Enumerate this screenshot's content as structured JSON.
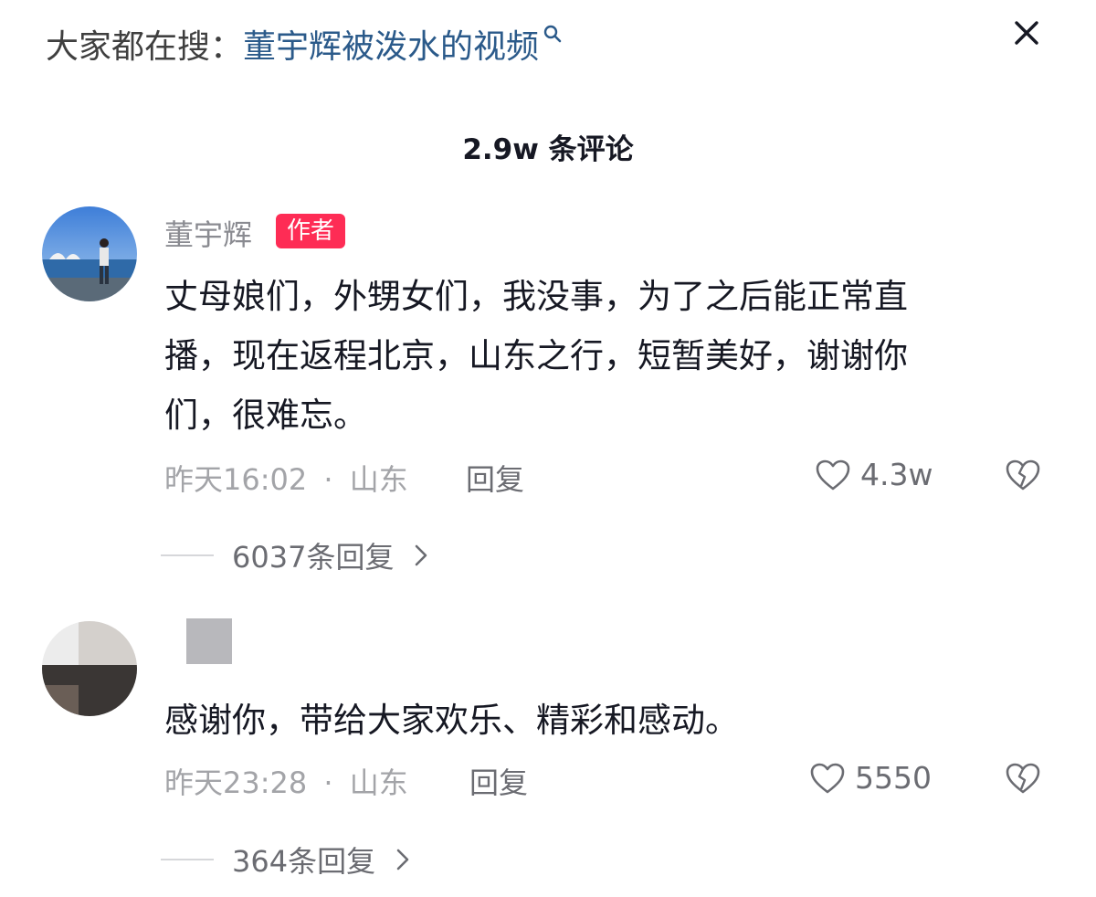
{
  "search": {
    "prefix": "大家都在搜：",
    "term": "董宇辉被泼水的视频"
  },
  "header": {
    "comment_count": "2.9w 条评论"
  },
  "comments": [
    {
      "username": "董宇辉",
      "badge": "作者",
      "text_lines": [
        "丈母娘们，外甥女们，我没事，为了之后能正常直",
        "播，现在返程北京，山东之行，短暂美好，谢谢你",
        "们，很难忘。"
      ],
      "time": "昨天16:02",
      "location": "山东",
      "separator": "·",
      "reply_label": "回复",
      "likes": "4.3w",
      "replies": "6037条回复"
    },
    {
      "username": "",
      "text_lines": [
        "感谢你，带给大家欢乐、精彩和感动。"
      ],
      "time": "昨天23:28",
      "location": "山东",
      "separator": "·",
      "reply_label": "回复",
      "likes": "5550",
      "replies": "364条回复"
    }
  ],
  "colors": {
    "badge": "#fe2c55",
    "search_term": "#2b5a8a",
    "meta": "#a3a4a8"
  },
  "icons": {
    "search": "search-icon",
    "close": "close-icon",
    "like": "heart-icon",
    "dislike": "broken-heart-icon",
    "expand": "chevron-right-icon"
  }
}
